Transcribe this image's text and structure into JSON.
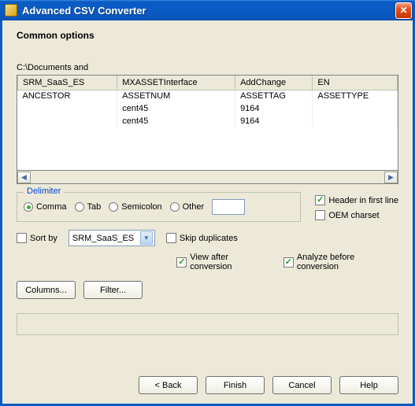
{
  "titlebar": {
    "title": "Advanced CSV Converter"
  },
  "section_title": "Common options",
  "path": "C:\\Documents and",
  "grid": {
    "headers": [
      "SRM_SaaS_ES",
      "MXASSETInterface",
      "AddChange",
      "EN"
    ],
    "rows": [
      [
        "ANCESTOR",
        "ASSETNUM",
        "ASSETTAG",
        "ASSETTYPE"
      ],
      [
        "",
        "cent45",
        "9164",
        ""
      ],
      [
        "",
        "cent45",
        "9164",
        ""
      ]
    ]
  },
  "delimiter": {
    "legend": "Delimiter",
    "options": {
      "comma": "Comma",
      "tab": "Tab",
      "semicolon": "Semicolon",
      "other": "Other"
    },
    "other_value": ""
  },
  "checks": {
    "header_first": "Header in first line",
    "oem": "OEM charset",
    "sort_by": "Sort by",
    "skip_dup": "Skip duplicates",
    "view_after": "View after conversion",
    "analyze": "Analyze before conversion"
  },
  "sort_select": "SRM_SaaS_ES",
  "buttons": {
    "columns": "Columns...",
    "filter": "Filter...",
    "back": "< Back",
    "finish": "Finish",
    "cancel": "Cancel",
    "help": "Help"
  }
}
